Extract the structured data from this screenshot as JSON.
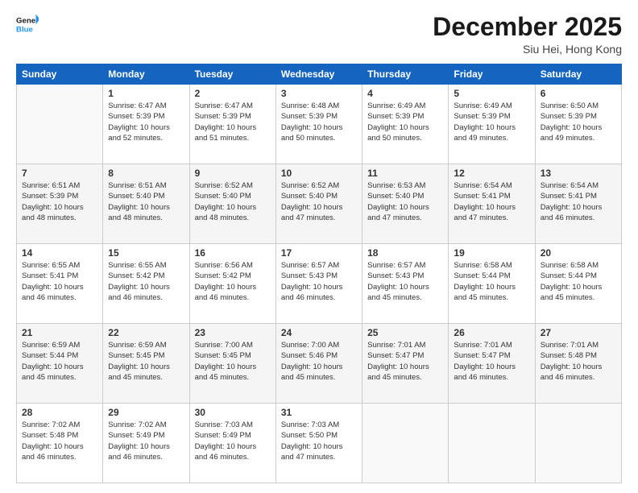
{
  "logo": {
    "line1": "General",
    "line2": "Blue"
  },
  "title": "December 2025",
  "location": "Siu Hei, Hong Kong",
  "days_header": [
    "Sunday",
    "Monday",
    "Tuesday",
    "Wednesday",
    "Thursday",
    "Friday",
    "Saturday"
  ],
  "weeks": [
    [
      {
        "day": "",
        "info": ""
      },
      {
        "day": "1",
        "info": "Sunrise: 6:47 AM\nSunset: 5:39 PM\nDaylight: 10 hours\nand 52 minutes."
      },
      {
        "day": "2",
        "info": "Sunrise: 6:47 AM\nSunset: 5:39 PM\nDaylight: 10 hours\nand 51 minutes."
      },
      {
        "day": "3",
        "info": "Sunrise: 6:48 AM\nSunset: 5:39 PM\nDaylight: 10 hours\nand 50 minutes."
      },
      {
        "day": "4",
        "info": "Sunrise: 6:49 AM\nSunset: 5:39 PM\nDaylight: 10 hours\nand 50 minutes."
      },
      {
        "day": "5",
        "info": "Sunrise: 6:49 AM\nSunset: 5:39 PM\nDaylight: 10 hours\nand 49 minutes."
      },
      {
        "day": "6",
        "info": "Sunrise: 6:50 AM\nSunset: 5:39 PM\nDaylight: 10 hours\nand 49 minutes."
      }
    ],
    [
      {
        "day": "7",
        "info": "Sunrise: 6:51 AM\nSunset: 5:39 PM\nDaylight: 10 hours\nand 48 minutes."
      },
      {
        "day": "8",
        "info": "Sunrise: 6:51 AM\nSunset: 5:40 PM\nDaylight: 10 hours\nand 48 minutes."
      },
      {
        "day": "9",
        "info": "Sunrise: 6:52 AM\nSunset: 5:40 PM\nDaylight: 10 hours\nand 48 minutes."
      },
      {
        "day": "10",
        "info": "Sunrise: 6:52 AM\nSunset: 5:40 PM\nDaylight: 10 hours\nand 47 minutes."
      },
      {
        "day": "11",
        "info": "Sunrise: 6:53 AM\nSunset: 5:40 PM\nDaylight: 10 hours\nand 47 minutes."
      },
      {
        "day": "12",
        "info": "Sunrise: 6:54 AM\nSunset: 5:41 PM\nDaylight: 10 hours\nand 47 minutes."
      },
      {
        "day": "13",
        "info": "Sunrise: 6:54 AM\nSunset: 5:41 PM\nDaylight: 10 hours\nand 46 minutes."
      }
    ],
    [
      {
        "day": "14",
        "info": "Sunrise: 6:55 AM\nSunset: 5:41 PM\nDaylight: 10 hours\nand 46 minutes."
      },
      {
        "day": "15",
        "info": "Sunrise: 6:55 AM\nSunset: 5:42 PM\nDaylight: 10 hours\nand 46 minutes."
      },
      {
        "day": "16",
        "info": "Sunrise: 6:56 AM\nSunset: 5:42 PM\nDaylight: 10 hours\nand 46 minutes."
      },
      {
        "day": "17",
        "info": "Sunrise: 6:57 AM\nSunset: 5:43 PM\nDaylight: 10 hours\nand 46 minutes."
      },
      {
        "day": "18",
        "info": "Sunrise: 6:57 AM\nSunset: 5:43 PM\nDaylight: 10 hours\nand 45 minutes."
      },
      {
        "day": "19",
        "info": "Sunrise: 6:58 AM\nSunset: 5:44 PM\nDaylight: 10 hours\nand 45 minutes."
      },
      {
        "day": "20",
        "info": "Sunrise: 6:58 AM\nSunset: 5:44 PM\nDaylight: 10 hours\nand 45 minutes."
      }
    ],
    [
      {
        "day": "21",
        "info": "Sunrise: 6:59 AM\nSunset: 5:44 PM\nDaylight: 10 hours\nand 45 minutes."
      },
      {
        "day": "22",
        "info": "Sunrise: 6:59 AM\nSunset: 5:45 PM\nDaylight: 10 hours\nand 45 minutes."
      },
      {
        "day": "23",
        "info": "Sunrise: 7:00 AM\nSunset: 5:45 PM\nDaylight: 10 hours\nand 45 minutes."
      },
      {
        "day": "24",
        "info": "Sunrise: 7:00 AM\nSunset: 5:46 PM\nDaylight: 10 hours\nand 45 minutes."
      },
      {
        "day": "25",
        "info": "Sunrise: 7:01 AM\nSunset: 5:47 PM\nDaylight: 10 hours\nand 45 minutes."
      },
      {
        "day": "26",
        "info": "Sunrise: 7:01 AM\nSunset: 5:47 PM\nDaylight: 10 hours\nand 46 minutes."
      },
      {
        "day": "27",
        "info": "Sunrise: 7:01 AM\nSunset: 5:48 PM\nDaylight: 10 hours\nand 46 minutes."
      }
    ],
    [
      {
        "day": "28",
        "info": "Sunrise: 7:02 AM\nSunset: 5:48 PM\nDaylight: 10 hours\nand 46 minutes."
      },
      {
        "day": "29",
        "info": "Sunrise: 7:02 AM\nSunset: 5:49 PM\nDaylight: 10 hours\nand 46 minutes."
      },
      {
        "day": "30",
        "info": "Sunrise: 7:03 AM\nSunset: 5:49 PM\nDaylight: 10 hours\nand 46 minutes."
      },
      {
        "day": "31",
        "info": "Sunrise: 7:03 AM\nSunset: 5:50 PM\nDaylight: 10 hours\nand 47 minutes."
      },
      {
        "day": "",
        "info": ""
      },
      {
        "day": "",
        "info": ""
      },
      {
        "day": "",
        "info": ""
      }
    ]
  ]
}
